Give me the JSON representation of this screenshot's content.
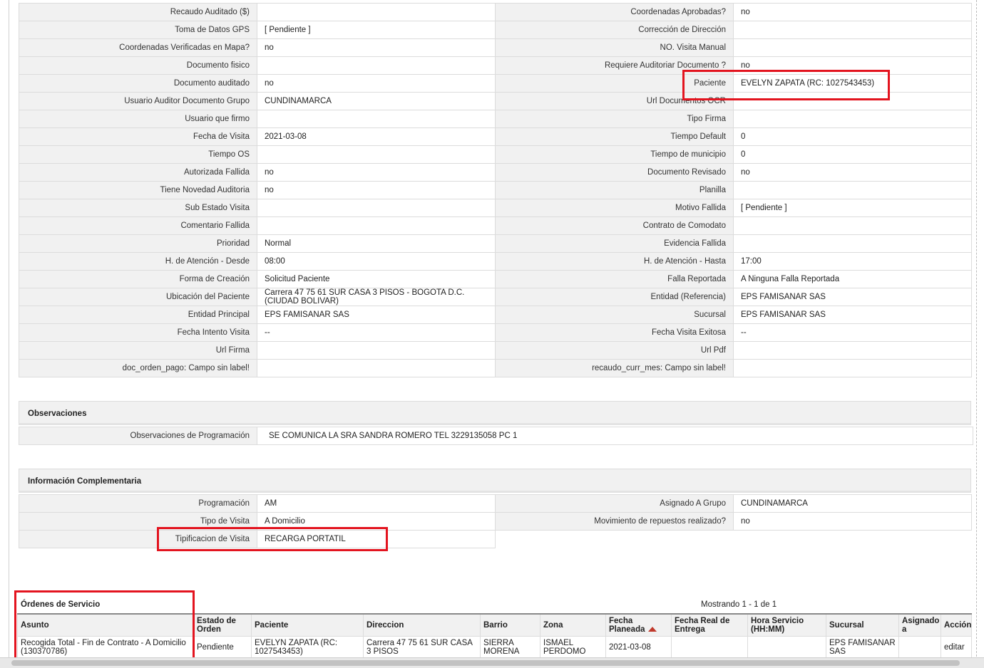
{
  "details": [
    [
      "Recaudo Auditado ($)",
      "",
      "Coordenadas Aprobadas?",
      "no"
    ],
    [
      "Toma de Datos GPS",
      "[ Pendiente ]",
      "Corrección de Dirección",
      ""
    ],
    [
      "Coordenadas Verificadas en Mapa?",
      "no",
      "NO. Visita Manual",
      ""
    ],
    [
      "Documento fisico",
      "",
      "Requiere Auditoriar Documento ?",
      "no"
    ],
    [
      "Documento auditado",
      "no",
      "Paciente",
      "EVELYN ZAPATA (RC: 1027543453)"
    ],
    [
      "Usuario Auditor Documento Grupo",
      "CUNDINAMARCA",
      "Url Documentos OCR",
      ""
    ],
    [
      "Usuario que firmo",
      "",
      "Tipo Firma",
      ""
    ],
    [
      "Fecha de Visita",
      "2021-03-08",
      "Tiempo Default",
      "0"
    ],
    [
      "Tiempo OS",
      "",
      "Tiempo de municipio",
      "0"
    ],
    [
      "Autorizada Fallida",
      "no",
      "Documento Revisado",
      "no"
    ],
    [
      "Tiene Novedad Auditoria",
      "no",
      "Planilla",
      ""
    ],
    [
      "Sub Estado Visita",
      "",
      "Motivo Fallida",
      "[ Pendiente ]"
    ],
    [
      "Comentario Fallida",
      "",
      "Contrato de Comodato",
      ""
    ],
    [
      "Prioridad",
      "Normal",
      "Evidencia Fallida",
      ""
    ],
    [
      "H. de Atención - Desde",
      "08:00",
      "H. de Atención - Hasta",
      "17:00"
    ],
    [
      "Forma de Creación",
      "Solicitud Paciente",
      "Falla Reportada",
      "A Ninguna Falla Reportada"
    ],
    [
      "Ubicación del Paciente",
      "Carrera 47 75 61 SUR CASA 3 PISOS - BOGOTA D.C. (CIUDAD BOLIVAR)",
      "Entidad (Referencia)",
      "EPS FAMISANAR SAS"
    ],
    [
      "Entidad Principal",
      "EPS FAMISANAR SAS",
      "Sucursal",
      "EPS FAMISANAR SAS"
    ],
    [
      "Fecha Intento Visita",
      "--",
      "Fecha Visita Exitosa",
      "--"
    ],
    [
      "Url Firma",
      "",
      "Url Pdf",
      ""
    ],
    [
      "doc_orden_pago: Campo sin label!",
      "",
      "recaudo_curr_mes: Campo sin label!",
      ""
    ]
  ],
  "observaciones": {
    "title": "Observaciones",
    "label": "Observaciones de Programación",
    "value": "SE COMUNICA LA SRA SANDRA ROMERO TEL 3229135058 PC 1"
  },
  "complementaria": {
    "title": "Información Complementaria",
    "rows": [
      [
        "Programación",
        "AM",
        "Asignado A Grupo",
        "CUNDINAMARCA"
      ],
      [
        "Tipo de Visita",
        "A Domicilio",
        "Movimiento de repuestos realizado?",
        "no"
      ],
      [
        "Tipificacion de Visita",
        "RECARGA PORTATIL"
      ]
    ]
  },
  "orders": {
    "title": "Órdenes de Servicio",
    "showing": "Mostrando 1 - 1 de 1",
    "columns": [
      "Asunto",
      "Estado de Orden",
      "Paciente",
      "Direccion",
      "Barrio",
      "Zona",
      "Fecha Planeada",
      "Fecha Real de Entrega",
      "Hora Servicio (HH:MM)",
      "Sucursal",
      "Asignado a",
      "Acción"
    ],
    "rows": [
      [
        "Recogida Total - Fin de Contrato - A Domicilio (130370786)",
        "Pendiente",
        "EVELYN ZAPATA (RC: 1027543453)",
        "Carrera 47 75 61 SUR CASA 3 PISOS",
        "SIERRA MORENA",
        "ISMAEL PERDOMO",
        "2021-03-08",
        "",
        "",
        "EPS FAMISANAR SAS",
        "",
        "editar"
      ]
    ]
  },
  "colors": {
    "highlight": "#e3141f",
    "label_bg": "#f1f1f1",
    "border": "#dcdcdc"
  }
}
